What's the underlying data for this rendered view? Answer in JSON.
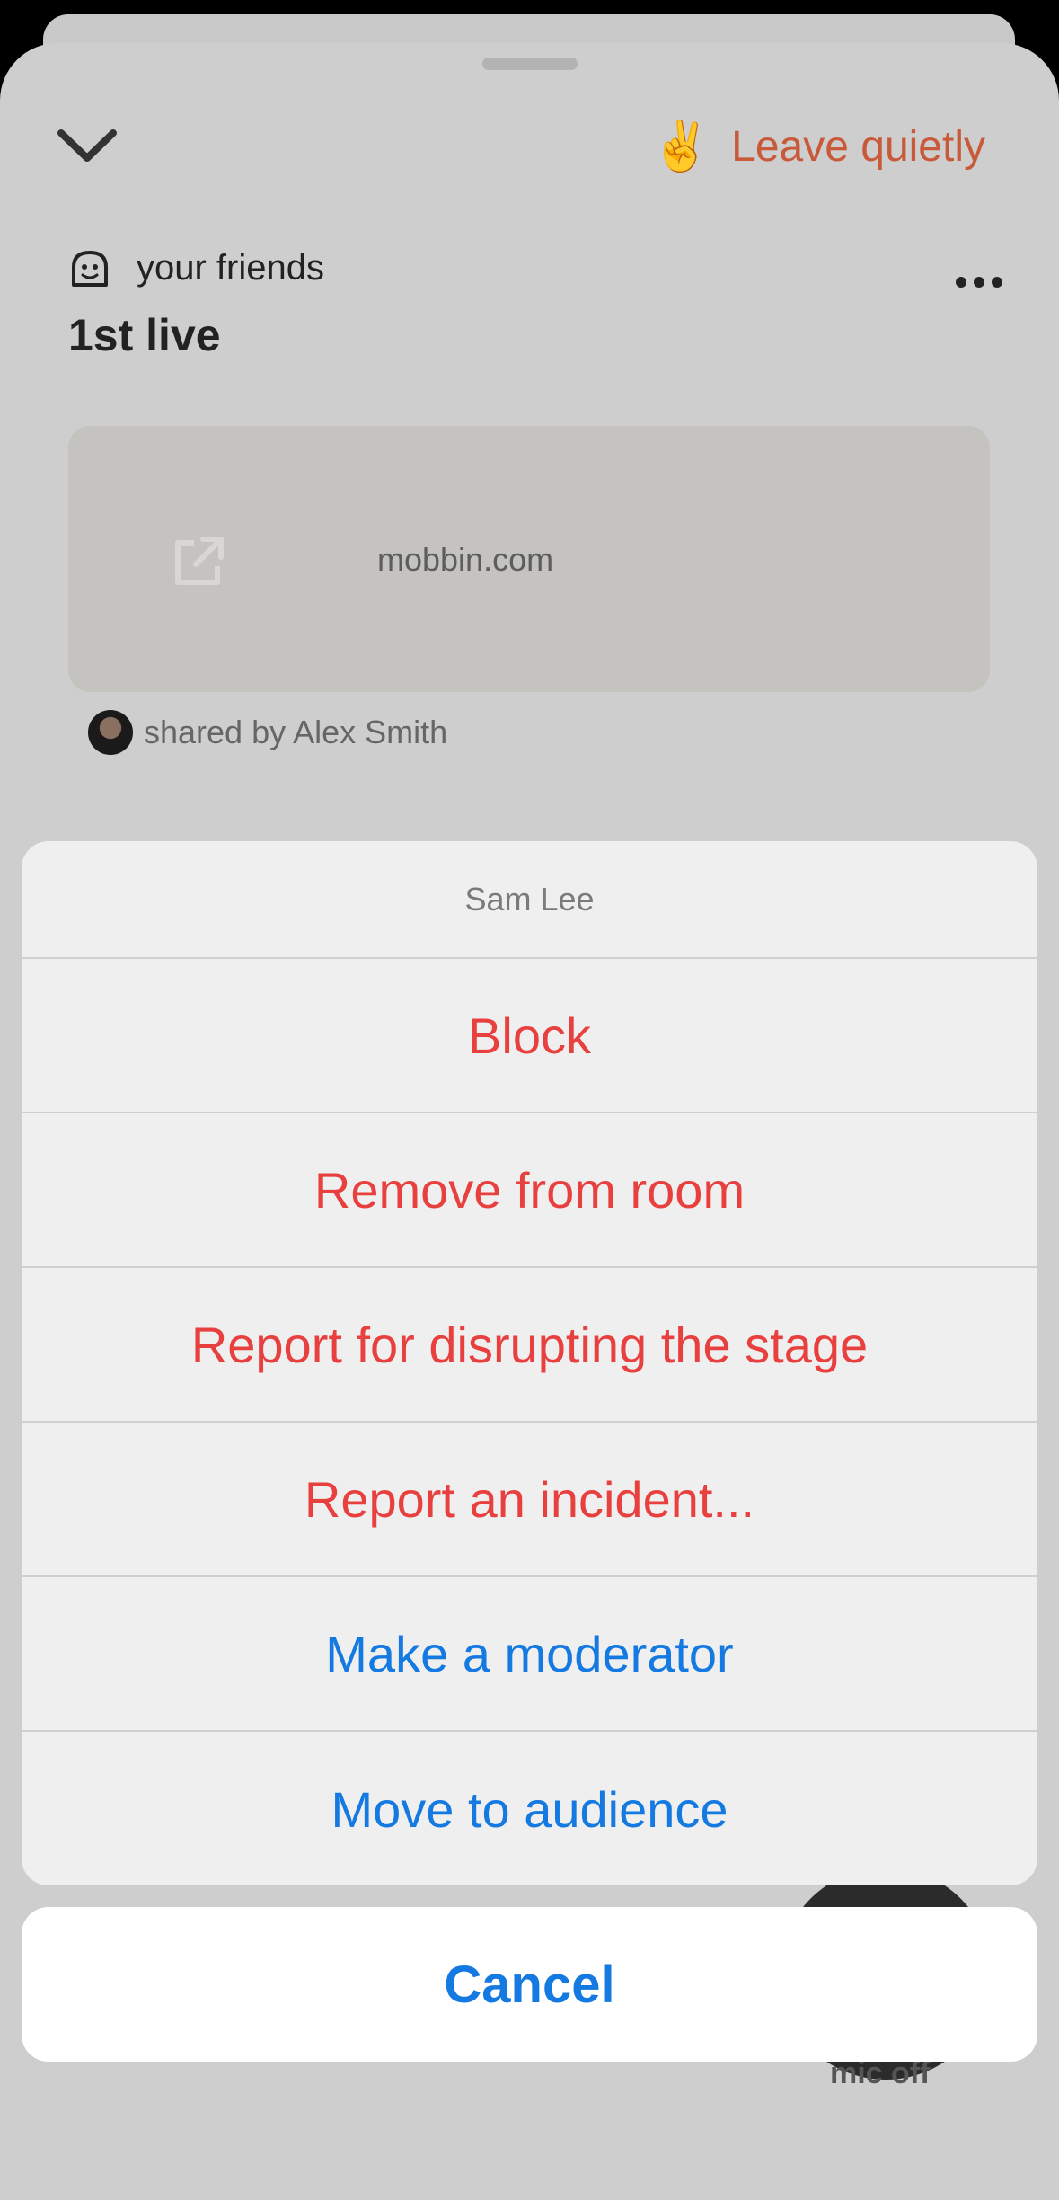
{
  "header": {
    "leave_emoji": "✌️",
    "leave_label": "Leave quietly"
  },
  "room": {
    "club_name": "your friends",
    "title": "1st live"
  },
  "shared_link": {
    "url_text": "mobbin.com",
    "shared_by": "shared by Alex Smith"
  },
  "speaker": {
    "status": "mic off"
  },
  "action_sheet": {
    "title": "Sam Lee",
    "actions": [
      {
        "label": "Block",
        "style": "destructive"
      },
      {
        "label": "Remove from room",
        "style": "destructive"
      },
      {
        "label": "Report for disrupting the stage",
        "style": "destructive"
      },
      {
        "label": "Report an incident...",
        "style": "destructive"
      },
      {
        "label": "Make a moderator",
        "style": "default"
      },
      {
        "label": "Move to audience",
        "style": "default"
      }
    ],
    "cancel_label": "Cancel"
  },
  "colors": {
    "destructive": "#e8403f",
    "action_blue": "#1479e0",
    "leave_orange": "#c85a3a"
  }
}
